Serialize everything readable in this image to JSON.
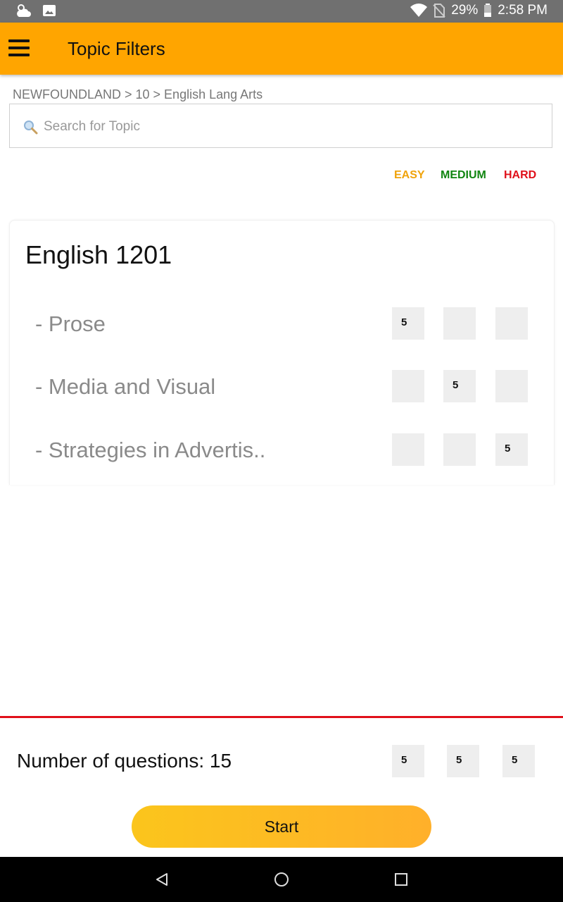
{
  "status_bar": {
    "battery": "29%",
    "time": "2:58 PM"
  },
  "app_bar": {
    "title": "Topic Filters"
  },
  "breadcrumb": "NEWFOUNDLAND > 10 > English Lang Arts",
  "search": {
    "placeholder": "Search for Topic",
    "value": ""
  },
  "difficulty_legend": {
    "easy": "EASY",
    "medium": "MEDIUM",
    "hard": "HARD",
    "colors": {
      "easy": "#F0A30A",
      "medium": "#108510",
      "hard": "#E0101A"
    }
  },
  "course": {
    "title": "English 1201",
    "topics": [
      {
        "label": "- Prose",
        "easy": "5",
        "medium": "",
        "hard": ""
      },
      {
        "label": "- Media and Visual",
        "easy": "",
        "medium": "5",
        "hard": ""
      },
      {
        "label": "- Strategies in Advertis..",
        "easy": "",
        "medium": "",
        "hard": "5"
      }
    ]
  },
  "summary": {
    "label": "Number of questions: 15",
    "easy": "5",
    "medium": "5",
    "hard": "5"
  },
  "start_button": "Start",
  "colors": {
    "accent": "#FFA500",
    "divider": "#E0101A"
  }
}
